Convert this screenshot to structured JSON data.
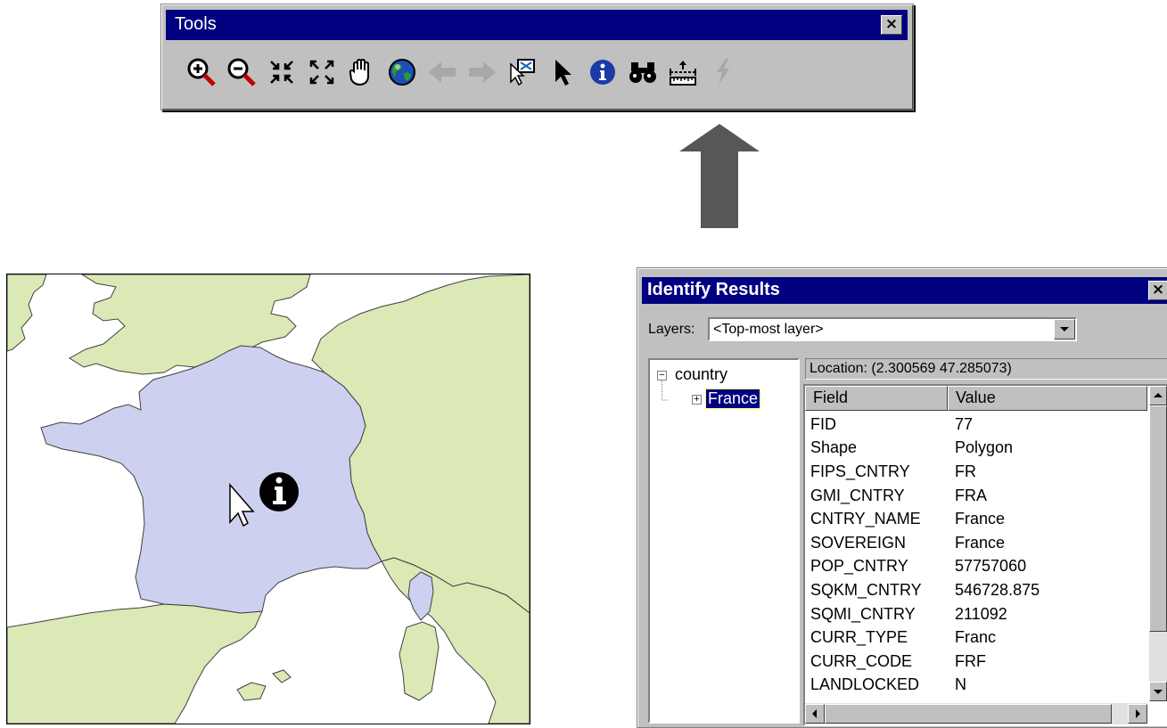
{
  "tools_window": {
    "title": "Tools",
    "close_glyph": "×",
    "tools": [
      {
        "name": "zoom-in-icon"
      },
      {
        "name": "zoom-out-icon"
      },
      {
        "name": "fixed-zoom-in-icon"
      },
      {
        "name": "fixed-zoom-out-icon"
      },
      {
        "name": "pan-hand-icon"
      },
      {
        "name": "full-extent-globe-icon"
      },
      {
        "name": "back-arrow-icon"
      },
      {
        "name": "forward-arrow-icon"
      },
      {
        "name": "select-features-icon"
      },
      {
        "name": "select-elements-pointer-icon"
      },
      {
        "name": "identify-icon"
      },
      {
        "name": "find-binoculars-icon"
      },
      {
        "name": "measure-icon"
      },
      {
        "name": "hyperlink-lightning-icon"
      }
    ]
  },
  "identify_results": {
    "title": "Identify Results",
    "close_glyph": "×",
    "layers_label": "Layers:",
    "layers_value": "<Top-most layer>",
    "tree": {
      "root": "country",
      "child": "France"
    },
    "location": "Location: (2.300569 47.285073)",
    "columns": {
      "field": "Field",
      "value": "Value"
    },
    "rows": [
      {
        "field": "FID",
        "value": "77"
      },
      {
        "field": "Shape",
        "value": "Polygon"
      },
      {
        "field": "FIPS_CNTRY",
        "value": "FR"
      },
      {
        "field": "GMI_CNTRY",
        "value": "FRA"
      },
      {
        "field": "CNTRY_NAME",
        "value": "France"
      },
      {
        "field": "SOVEREIGN",
        "value": "France"
      },
      {
        "field": "POP_CNTRY",
        "value": "57757060"
      },
      {
        "field": "SQKM_CNTRY",
        "value": "546728.875"
      },
      {
        "field": "SQMI_CNTRY",
        "value": "211092"
      },
      {
        "field": "CURR_TYPE",
        "value": "Franc"
      },
      {
        "field": "CURR_CODE",
        "value": "FRF"
      },
      {
        "field": "LANDLOCKED",
        "value": "N"
      }
    ]
  },
  "colors": {
    "title_bar": "#000080",
    "window_face": "#c0c0c0",
    "land": "#dbe9b6",
    "selected_country": "#cdd0ef",
    "arrow": "#575757"
  }
}
